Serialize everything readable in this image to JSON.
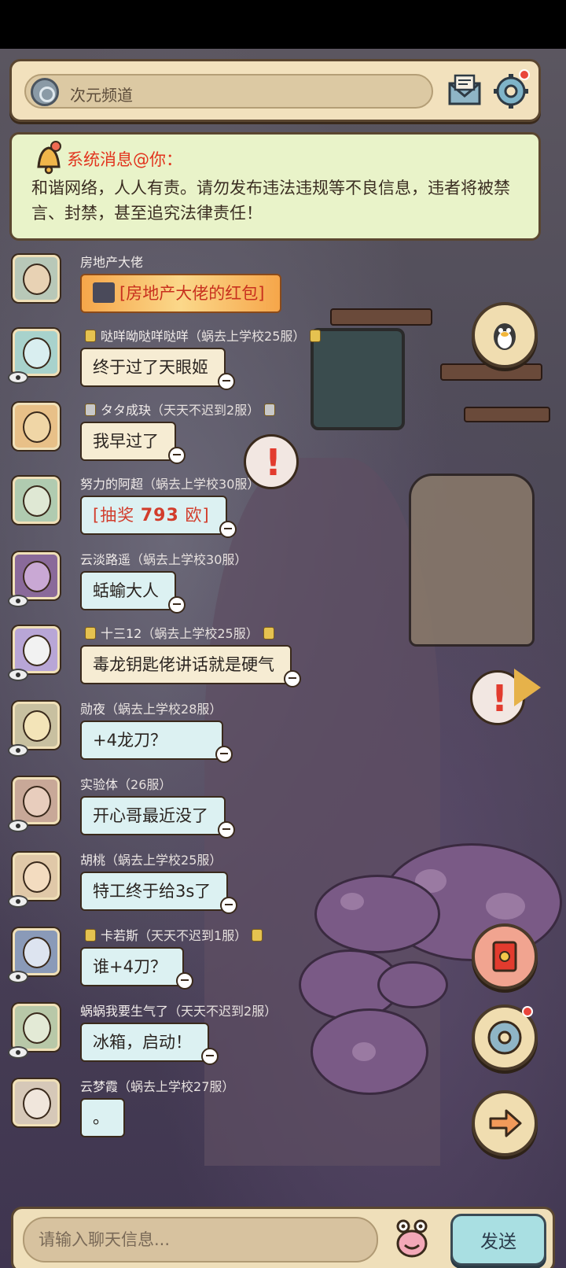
{
  "topbar": {
    "channel_label": "次元频道",
    "icons": [
      "channel-icon",
      "mail-icon",
      "settings-icon"
    ]
  },
  "system_message": {
    "title": "系统消息@你：",
    "body": "和谐网络，人人有责。请勿发布违法违规等不良信息，违者将被禁言、封禁，甚至追究法律责任！"
  },
  "messages": [
    {
      "name": "房地产大佬",
      "server": "",
      "text": "[房地产大佬的红包]"
    },
    {
      "name": "哒咩呦哒咩哒咩",
      "server": "（蜗去上学校25服）",
      "text": "终于过了天眼姬"
    },
    {
      "name": "タタ成玦",
      "server": "（天天不迟到2服）",
      "text": "我早过了"
    },
    {
      "name": "努力的阿超",
      "server": "（蜗去上学校30服）",
      "text_prefix": "[抽奖 ",
      "text_value": "793",
      "text_suffix": " 欧]"
    },
    {
      "name": "云淡路遥",
      "server": "（蜗去上学校30服）",
      "text": "蛞蝓大人"
    },
    {
      "name": "十三12",
      "server": "（蜗去上学校25服）",
      "text": "毒龙钥匙佬讲话就是硬气"
    },
    {
      "name": "勋夜",
      "server": "（蜗去上学校28服）",
      "text": "+4龙刀？"
    },
    {
      "name": "实验体",
      "server": "（26服）",
      "text": "开心哥最近没了"
    },
    {
      "name": "胡桃",
      "server": "（蜗去上学校25服）",
      "text": "特工终于给3s了"
    },
    {
      "name": "卡若斯",
      "server": "（天天不迟到1服）",
      "text": "谁+4刀？"
    },
    {
      "name": "蜗蜗我要生气了",
      "server": "（天天不迟到2服）",
      "text": "冰箱，启动！"
    },
    {
      "name": "云梦霞",
      "server": "（蜗去上学校27服）",
      "text": "。"
    }
  ],
  "input": {
    "placeholder": "请输入聊天信息...",
    "send_label": "发送"
  },
  "colors": {
    "accent_red": "#e2341e",
    "panel_cream": "#f2e1bd",
    "send_cyan": "#a9dfe2"
  }
}
